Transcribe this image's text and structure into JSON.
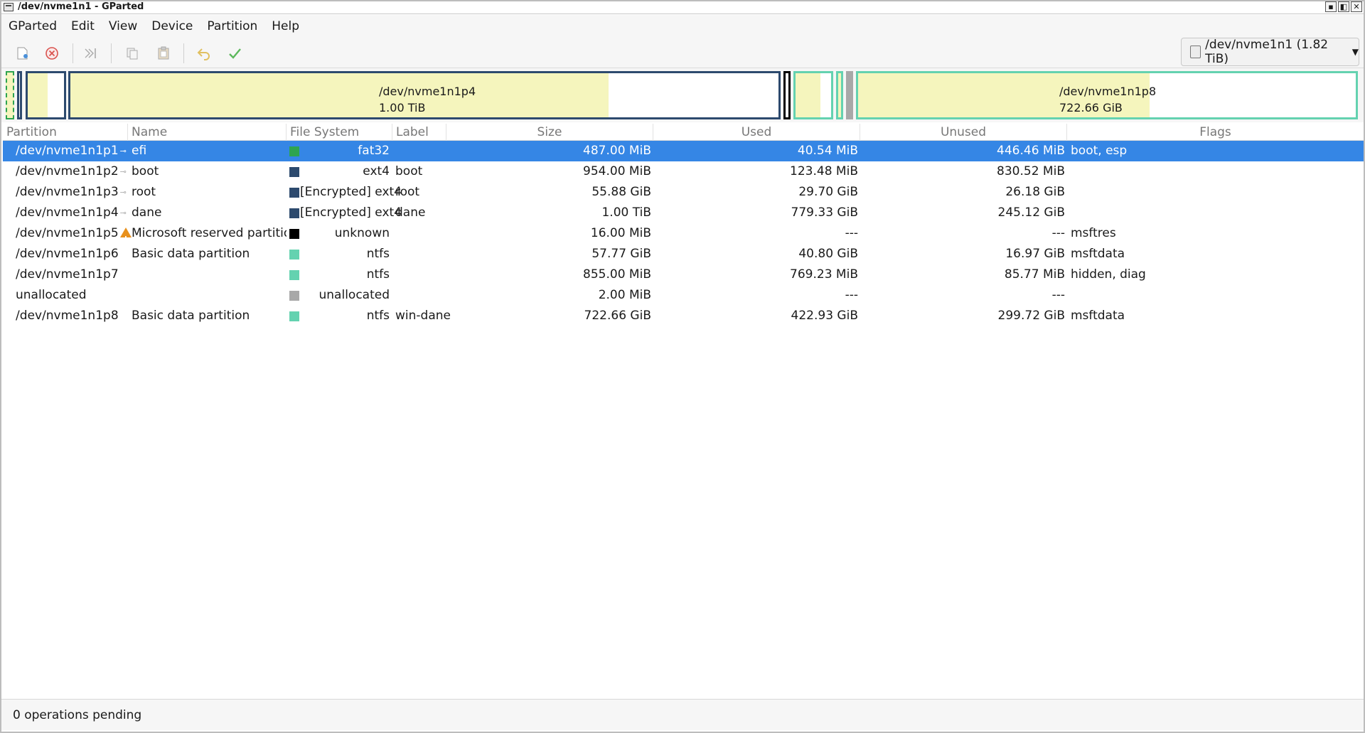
{
  "window": {
    "title": "/dev/nvme1n1 - GParted",
    "controls": [
      "▪",
      "◧",
      "✕"
    ]
  },
  "menu": [
    "GParted",
    "Edit",
    "View",
    "Device",
    "Partition",
    "Help"
  ],
  "toolbar": {
    "buttons": [
      "new-icon",
      "delete-icon",
      "resize-move-icon",
      "copy-icon",
      "paste-icon",
      "undo-icon",
      "apply-icon"
    ],
    "device_selector": "/dev/nvme1n1 (1.82 TiB)"
  },
  "partition_map": {
    "p4": {
      "name": "/dev/nvme1n1p4",
      "size": "1.00 TiB",
      "used_fraction": 0.76
    },
    "p8": {
      "name": "/dev/nvme1n1p8",
      "size": "722.66 GiB",
      "used_fraction": 0.585
    }
  },
  "table": {
    "columns": [
      "Partition",
      "Name",
      "File System",
      "Label",
      "Size",
      "Used",
      "Unused",
      "Flags"
    ],
    "rows": [
      {
        "partition": "/dev/nvme1n1p1",
        "icon": "key-icon",
        "name": "efi",
        "fs": "fat32",
        "fs_color": "#2ea44f",
        "label": "",
        "size": "487.00 MiB",
        "used": "40.54 MiB",
        "unused": "446.46 MiB",
        "flags": "boot, esp",
        "selected": true
      },
      {
        "partition": "/dev/nvme1n1p2",
        "icon": "key-icon",
        "name": "boot",
        "fs": "ext4",
        "fs_color": "#2d4a6e",
        "label": "boot",
        "size": "954.00 MiB",
        "used": "123.48 MiB",
        "unused": "830.52 MiB",
        "flags": ""
      },
      {
        "partition": "/dev/nvme1n1p3",
        "icon": "key-icon",
        "name": "root",
        "fs": "[Encrypted] ext4",
        "fs_color": "#2d4a6e",
        "label": "root",
        "size": "55.88 GiB",
        "used": "29.70 GiB",
        "unused": "26.18 GiB",
        "flags": ""
      },
      {
        "partition": "/dev/nvme1n1p4",
        "icon": "key-icon",
        "name": "dane",
        "fs": "[Encrypted] ext4",
        "fs_color": "#2d4a6e",
        "label": "dane",
        "size": "1.00 TiB",
        "used": "779.33 GiB",
        "unused": "245.12 GiB",
        "flags": ""
      },
      {
        "partition": "/dev/nvme1n1p5",
        "icon": "warning-icon",
        "name": "Microsoft reserved partition",
        "fs": "unknown",
        "fs_color": "#000000",
        "label": "",
        "size": "16.00 MiB",
        "used": "---",
        "unused": "---",
        "flags": "msftres"
      },
      {
        "partition": "/dev/nvme1n1p6",
        "icon": "",
        "name": "Basic data partition",
        "fs": "ntfs",
        "fs_color": "#64d2b0",
        "label": "",
        "size": "57.77 GiB",
        "used": "40.80 GiB",
        "unused": "16.97 GiB",
        "flags": "msftdata"
      },
      {
        "partition": "/dev/nvme1n1p7",
        "icon": "",
        "name": "",
        "fs": "ntfs",
        "fs_color": "#64d2b0",
        "label": "",
        "size": "855.00 MiB",
        "used": "769.23 MiB",
        "unused": "85.77 MiB",
        "flags": "hidden, diag"
      },
      {
        "partition": "unallocated",
        "icon": "",
        "name": "",
        "fs": "unallocated",
        "fs_color": "#a8a8a8",
        "label": "",
        "size": "2.00 MiB",
        "used": "---",
        "unused": "---",
        "flags": ""
      },
      {
        "partition": "/dev/nvme1n1p8",
        "icon": "",
        "name": "Basic data partition",
        "fs": "ntfs",
        "fs_color": "#64d2b0",
        "label": "win-dane",
        "size": "722.66 GiB",
        "used": "422.93 GiB",
        "unused": "299.72 GiB",
        "flags": "msftdata"
      }
    ]
  },
  "status": "0 operations pending"
}
